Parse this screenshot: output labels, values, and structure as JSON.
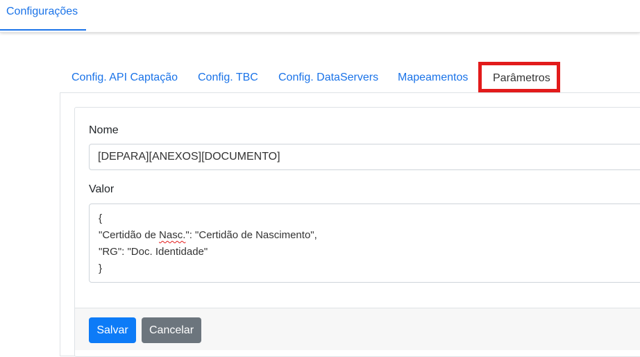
{
  "header": {
    "tab_label": "Configurações"
  },
  "tabs": [
    {
      "label": "Config. API Captação"
    },
    {
      "label": "Config. TBC"
    },
    {
      "label": "Config. DataServers"
    },
    {
      "label": "Mapeamentos"
    },
    {
      "label": "Parâmetros",
      "active": true
    }
  ],
  "form": {
    "name_label": "Nome",
    "name_value": "[DEPARA][ANEXOS][DOCUMENTO]",
    "value_label": "Valor",
    "value_lines": {
      "l1": "{",
      "l2a": "\"Certidão de ",
      "l2b": "Nasc.",
      "l2c": "\": \"Certidão de Nascimento\",",
      "l3": "\"RG\": \"Doc. Identidade\"",
      "l4": "}"
    }
  },
  "buttons": {
    "save": "Salvar",
    "cancel": "Cancelar"
  },
  "colors": {
    "accent": "#1a73e8",
    "highlight": "#e21b1b",
    "primary_button": "#0d7bf7",
    "secondary_button": "#6c757d"
  }
}
